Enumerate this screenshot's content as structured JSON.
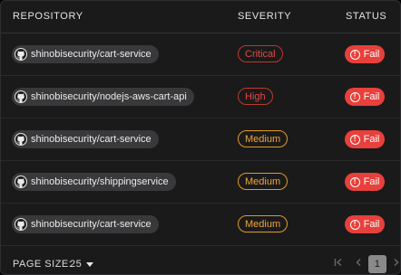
{
  "table": {
    "headers": {
      "repository": "REPOSITORY",
      "severity": "SEVERITY",
      "status": "STATUS"
    },
    "rows": [
      {
        "repo": "shinobisecurity/cart-service",
        "severity": "Critical",
        "severity_level": "critical",
        "status": "Fail"
      },
      {
        "repo": "shinobisecurity/nodejs-aws-cart-api",
        "severity": "High",
        "severity_level": "high",
        "status": "Fail"
      },
      {
        "repo": "shinobisecurity/cart-service",
        "severity": "Medium",
        "severity_level": "medium",
        "status": "Fail"
      },
      {
        "repo": "shinobisecurity/shippingservice",
        "severity": "Medium",
        "severity_level": "medium",
        "status": "Fail"
      },
      {
        "repo": "shinobisecurity/cart-service",
        "severity": "Medium",
        "severity_level": "medium",
        "status": "Fail"
      }
    ]
  },
  "footer": {
    "page_size_label": "PAGE SIZE:",
    "page_size_value": "25",
    "current_page": "1"
  },
  "colors": {
    "fail": "#e8403b",
    "critical": "#c0392b",
    "medium": "#e09b25",
    "background": "#1a1a1b"
  },
  "icons": {
    "repo": "github-icon",
    "status": "exclamation-circle-icon",
    "page_size": "chevron-down-icon",
    "first": "first-page-icon",
    "prev": "chevron-left-icon",
    "next": "chevron-right-icon"
  }
}
